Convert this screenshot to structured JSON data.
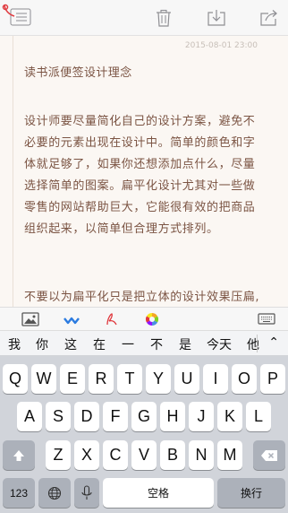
{
  "toolbar": {
    "menu_icon": "note-list-icon",
    "trash_icon": "trash-icon",
    "download_icon": "download-icon",
    "share_icon": "share-icon"
  },
  "note": {
    "date": "2015-08-01 23:00",
    "title": "读书派便签设计理念",
    "paragraphs": [
      "设计师要尽量简化自己的设计方案，避免不必要的元素出现在设计中。简单的颜色和字体就足够了，如果你还想添加点什么，尽量选择简单的图案。扁平化设计尤其对一些做零售的网站帮助巨大，它能很有效的把商品组织起来，以简单但合理方式排列。",
      "不要以为扁平化只是把立体的设计效果压扁,"
    ],
    "accent_color": "#7b5443"
  },
  "formatbar": {
    "image_icon": "image-icon",
    "style_icon": "text-style-icon",
    "draw_icon": "handwriting-icon",
    "color_icon": "color-wheel-icon",
    "hide_keyboard_icon": "hide-keyboard-icon"
  },
  "candidates": [
    "我",
    "你",
    "这",
    "在",
    "一",
    "不",
    "是",
    "今天",
    "他"
  ],
  "candidate_expand": "⌃",
  "keyboard": {
    "row1": [
      "Q",
      "W",
      "E",
      "R",
      "T",
      "Y",
      "U",
      "I",
      "O",
      "P"
    ],
    "row2": [
      "A",
      "S",
      "D",
      "F",
      "G",
      "H",
      "J",
      "K",
      "L"
    ],
    "row3": [
      "Z",
      "X",
      "C",
      "V",
      "B",
      "N",
      "M"
    ],
    "num_label": "123",
    "space_label": "空格",
    "return_label": "换行"
  }
}
